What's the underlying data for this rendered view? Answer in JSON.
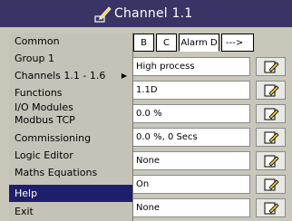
{
  "title": "Channel 1.1",
  "tabs": [
    "B",
    "C",
    "Alarm D",
    "--->"
  ],
  "menu": {
    "items": [
      {
        "label": "Common"
      },
      {
        "label": "Group 1"
      },
      {
        "label": "Channels 1.1 - 1.6",
        "has_submenu": true
      },
      {
        "label": "Functions"
      },
      {
        "label": "I/O Modules"
      },
      {
        "label": "Modbus TCP"
      },
      {
        "label": "Commissioning"
      },
      {
        "label": "Logic Editor"
      },
      {
        "label": "Maths Equations"
      },
      {
        "label": "Help",
        "selected": true
      },
      {
        "label": "Exit"
      }
    ],
    "submenu_arrow": "▶"
  },
  "fields": [
    "High process",
    "1.1D",
    "0.0 %",
    "0.0 %, 0 Secs",
    "None",
    "On",
    "None"
  ],
  "colors": {
    "titlebar": "#3a3466",
    "panel": "#c9c7ba",
    "menu_bg": "#c5c3b8",
    "menu_selected": "#1e1f6b"
  }
}
